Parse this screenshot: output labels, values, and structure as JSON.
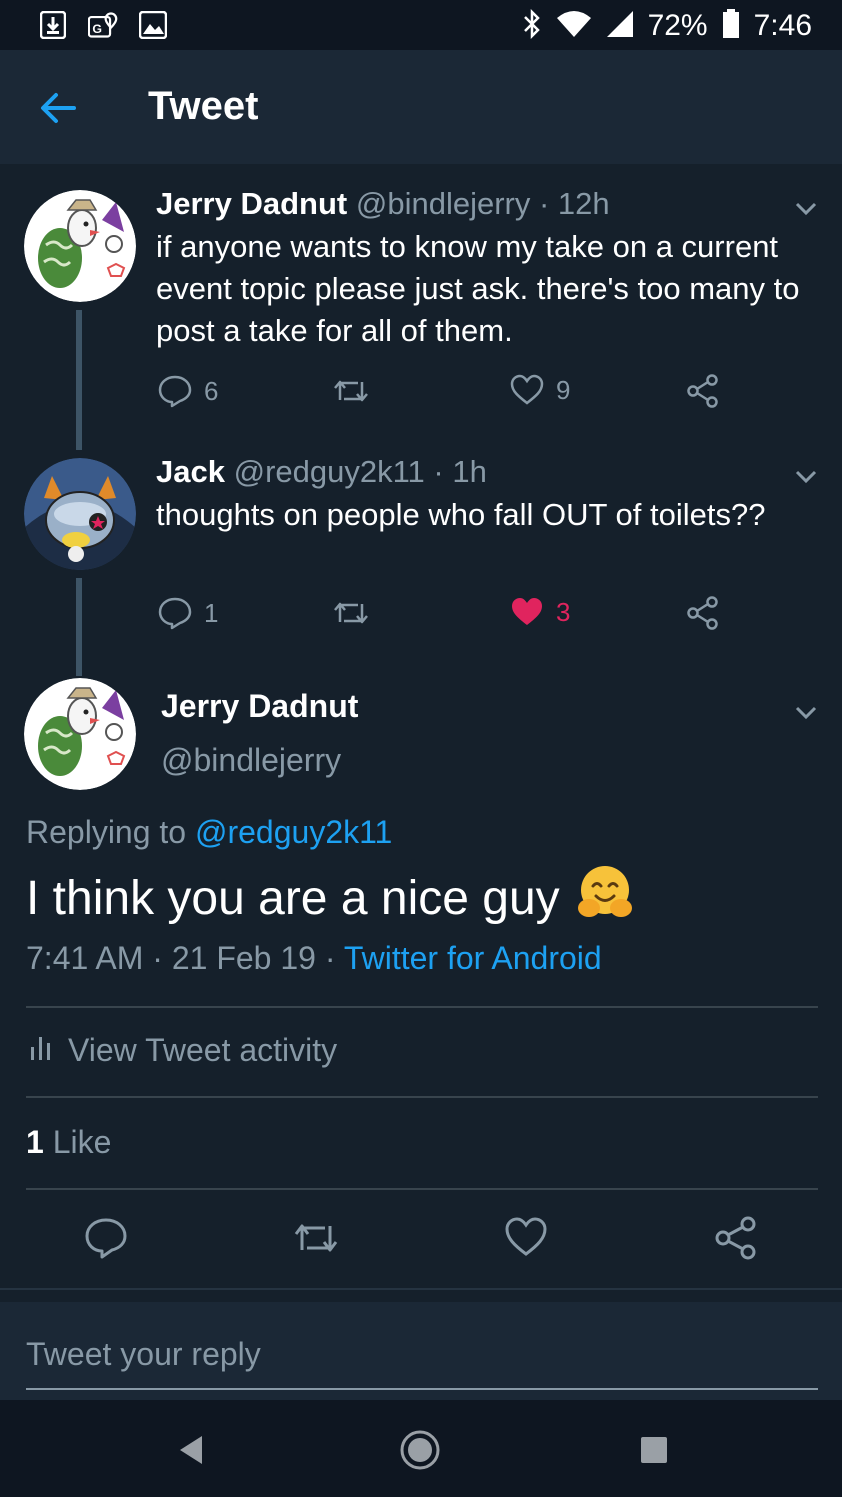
{
  "status_bar": {
    "battery": "72%",
    "time": "7:46"
  },
  "header": {
    "title": "Tweet"
  },
  "thread": [
    {
      "name": "Jerry Dadnut",
      "handle": "@bindlejerry",
      "time": "12h",
      "text": "if anyone wants to know my take on a current event topic please just ask.  there's too many to post a take for all of them.",
      "replies": "6",
      "retweets": "",
      "likes": "9",
      "liked": false
    },
    {
      "name": "Jack",
      "handle": "@redguy2k11",
      "time": "1h",
      "text": "thoughts on people who fall OUT of toilets??",
      "replies": "1",
      "retweets": "",
      "likes": "3",
      "liked": true
    }
  ],
  "main_tweet": {
    "name": "Jerry Dadnut",
    "handle": "@bindlejerry",
    "replying_prefix": "Replying to",
    "replying_to": "@redguy2k11",
    "text": "I think you are a nice guy",
    "emoji": "hugging-face-icon",
    "timestamp": "7:41 AM",
    "date": "21 Feb 19",
    "client": "Twitter for Android",
    "activity_label": "View Tweet activity",
    "like_count": "1",
    "like_label": "Like"
  },
  "reply_bar": {
    "placeholder": "Tweet your reply"
  },
  "colors": {
    "background": "#15202b",
    "header": "#1b2836",
    "accent": "#1da1f2",
    "muted": "#8899a6",
    "like": "#e0245e"
  }
}
